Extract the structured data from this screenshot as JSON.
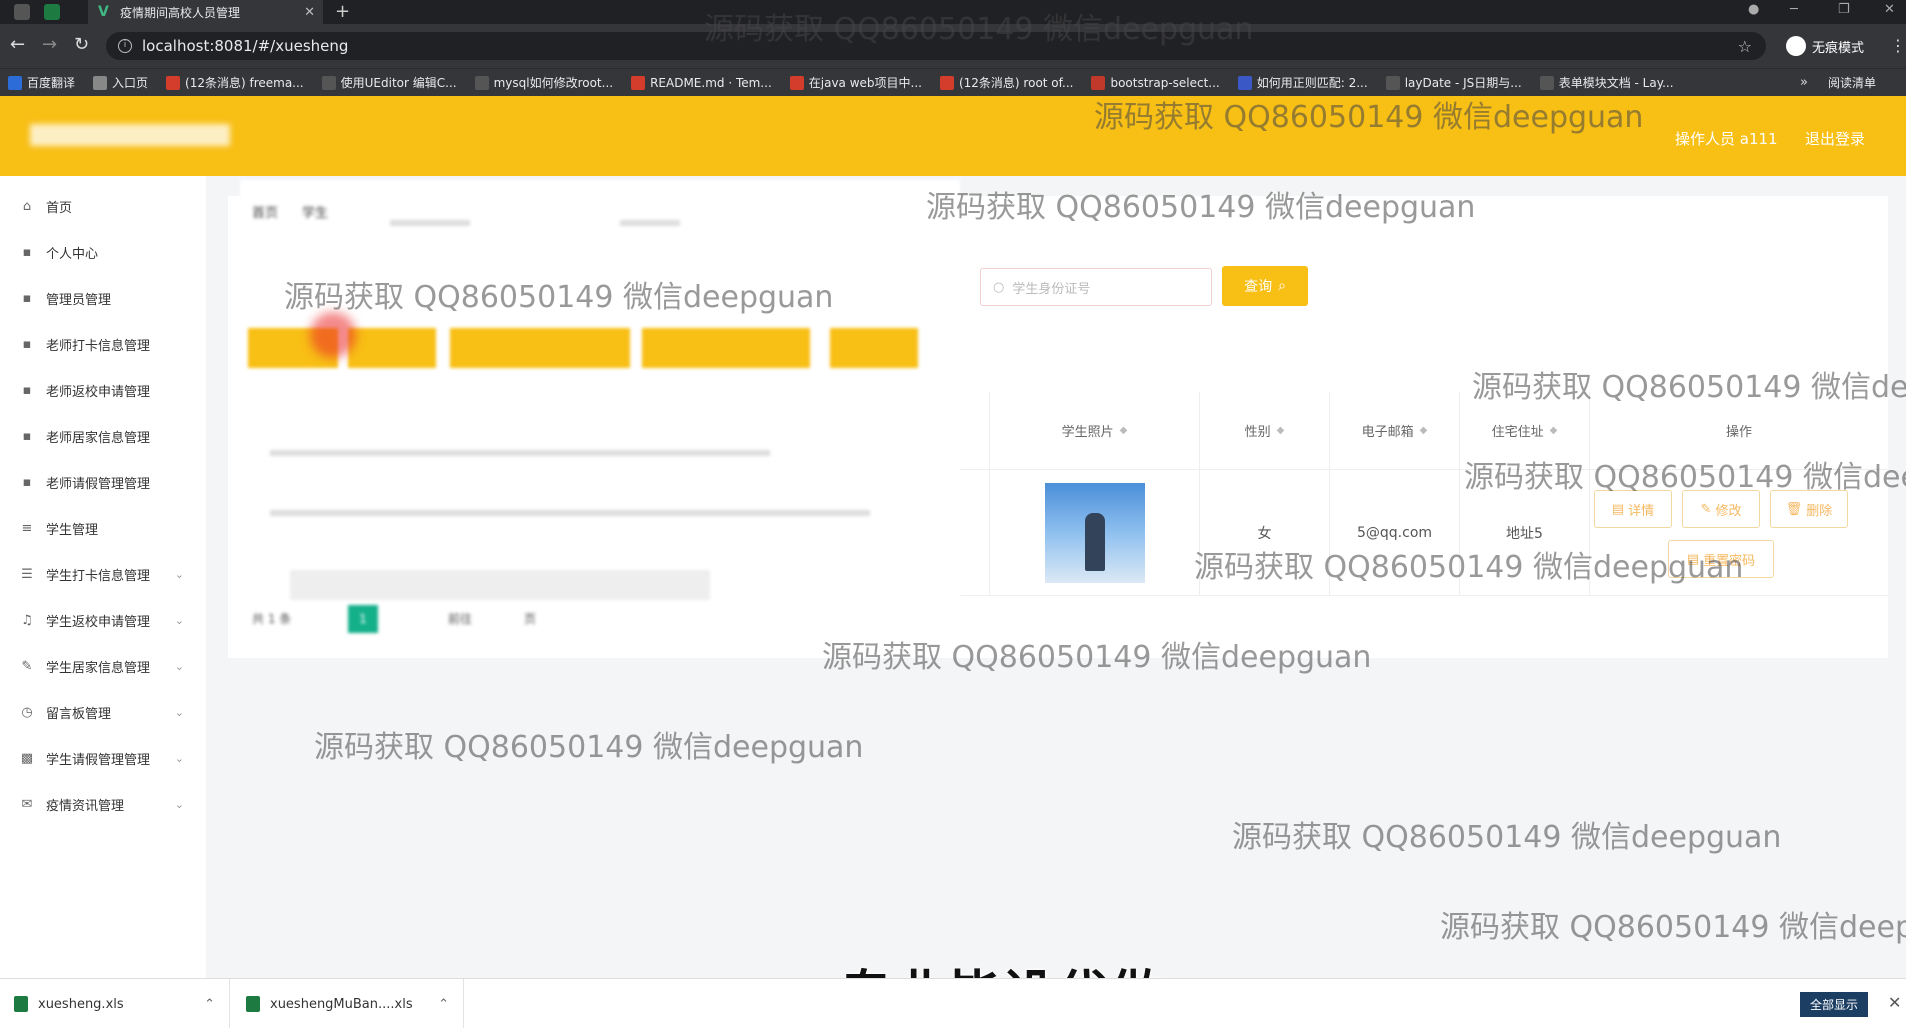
{
  "browser": {
    "tab_title": "疫情期间高校人员管理",
    "url": "localhost:8081/#/xuesheng",
    "incognito_label": "无痕模式",
    "bookmarks": [
      {
        "label": "百度翻译",
        "color": "#2b6cd8"
      },
      {
        "label": "入口页",
        "color": "#888"
      },
      {
        "label": "(12条消息) freema...",
        "color": "#d43c2c"
      },
      {
        "label": "使用UEditor 编辑C...",
        "color": "#555"
      },
      {
        "label": "mysql如何修改root...",
        "color": "#555"
      },
      {
        "label": "README.md · Tem...",
        "color": "#d43c2c"
      },
      {
        "label": "在java web项目中...",
        "color": "#d43c2c"
      },
      {
        "label": "(12条消息) root of...",
        "color": "#d43c2c"
      },
      {
        "label": "bootstrap-select...",
        "color": "#c0392b"
      },
      {
        "label": "如何用正则匹配: 2...",
        "color": "#3a59c7"
      },
      {
        "label": "layDate - JS日期与...",
        "color": "#555"
      },
      {
        "label": "表单模块文档 - Lay...",
        "color": "#555"
      }
    ],
    "reading_list": "阅读清单"
  },
  "header": {
    "operator": "操作人员 a111",
    "logout": "退出登录"
  },
  "sidebar": {
    "items": [
      {
        "label": "首页",
        "icon": "home-icon"
      },
      {
        "label": "个人中心",
        "icon": "user-icon"
      },
      {
        "label": "管理员管理",
        "icon": "admin-icon"
      },
      {
        "label": "老师打卡信息管理",
        "icon": "list-icon"
      },
      {
        "label": "老师返校申请管理",
        "icon": "list-icon"
      },
      {
        "label": "老师居家信息管理",
        "icon": "list-icon"
      },
      {
        "label": "老师请假管理管理",
        "icon": "list-icon"
      },
      {
        "label": "学生管理",
        "icon": "student-icon"
      },
      {
        "label": "学生打卡信息管理",
        "icon": "menu-icon"
      },
      {
        "label": "学生返校申请管理",
        "icon": "mic-icon"
      },
      {
        "label": "学生居家信息管理",
        "icon": "edit-icon"
      },
      {
        "label": "留言板管理",
        "icon": "clock-icon"
      },
      {
        "label": "学生请假管理管理",
        "icon": "image-icon"
      },
      {
        "label": "疫情资讯管理",
        "icon": "mail-icon"
      }
    ]
  },
  "overlay": {
    "breadcrumb_home": "首页",
    "breadcrumb_current": "学生",
    "page_current": "1",
    "page_goto": "前往",
    "page_unit": "页",
    "page_total": "共 1 条"
  },
  "search": {
    "placeholder": "学生身份证号",
    "button": "查询"
  },
  "table": {
    "columns": [
      "学生照片",
      "性别",
      "电子邮箱",
      "住宅住址",
      "操作"
    ],
    "rows": [
      {
        "gender": "女",
        "email": "5@qq.com",
        "address": "地址5"
      }
    ],
    "actions": {
      "detail": "详情",
      "edit": "修改",
      "delete": "删除",
      "reset": "重置密码"
    }
  },
  "watermark": "源码获取 QQ86050149 微信deepguan",
  "subtitle": "专业毕设代做",
  "downloads": [
    {
      "name": "xuesheng.xls"
    },
    {
      "name": "xueshengMuBan....xls"
    }
  ],
  "download_show_all": "全部显示"
}
